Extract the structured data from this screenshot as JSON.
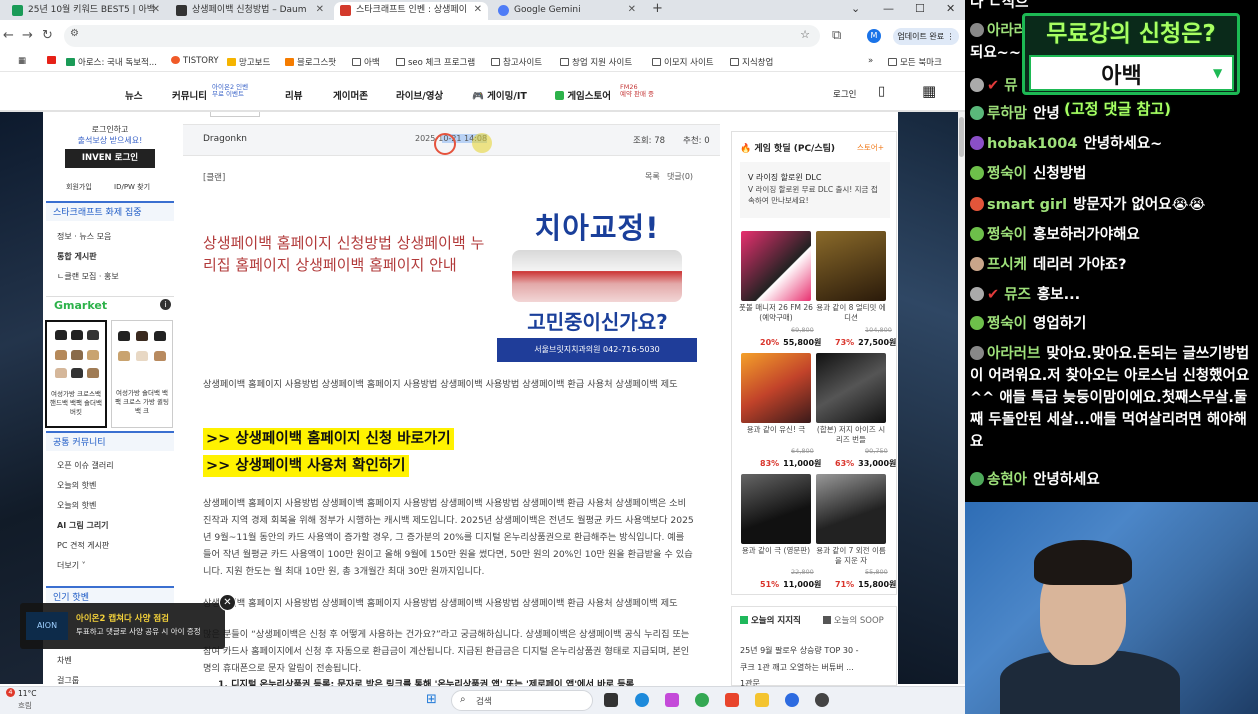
{
  "browser": {
    "tabs": [
      {
        "label": "25년 10월 키워드 BEST5 | 아백",
        "color": "#1a9b57"
      },
      {
        "label": "상생페이백 신청방법 – Daum",
        "color": "#333333"
      },
      {
        "label": "스타크래프트 인벤 : 상생페이",
        "color": "#d33a2c"
      },
      {
        "label": "Google Gemini",
        "color": "#4e7cf6"
      }
    ],
    "new_tab": "+",
    "window_controls": [
      "⌄",
      "—",
      "☐",
      "✕"
    ],
    "profile": "M",
    "update_label": "업데이트 완료 ⋮",
    "bookmarks": [
      "아로스: 국내 독보적...",
      "TISTORY",
      "망고보드",
      "블로그스팟",
      "아백",
      "seo 체크 프로그램",
      "참고사이트",
      "창업 지원 사이트",
      "이모지 사이트",
      "지식창업"
    ],
    "all_bookmarks": "모든 북마크"
  },
  "site": {
    "nav": [
      "뉴스",
      "커뮤니티",
      "리뷰",
      "게이머존",
      "라이브/영상",
      "게이밍/IT",
      "게임스토어",
      "로그인"
    ],
    "community_sub": "아이온2 인벤\n무료 이벤트",
    "store_sub": "FM26\n예약 판매 중",
    "login_box": {
      "line1": "로그인하고",
      "line2": "출석보상 받으세요!",
      "button": "INVEN 로그인",
      "signup": "회원가입",
      "find": "ID/PW 찾기"
    },
    "left_menu": {
      "header1": "스타크래프트 화제 집중",
      "items1": [
        "정보 · 뉴스 모음",
        "통합 게시판",
        "ㄴ클랜 모집 · 홍보"
      ],
      "gmarket": "Gmarket",
      "gm_products": [
        "여성가방 크로스백 핸드백 백팩 숄더백 버킷",
        "여성가방 숄더백 백팩 크로스 가방 퀼팅백 크"
      ],
      "header2": "공통 커뮤니티",
      "items2": [
        "오픈 이슈 갤러리",
        "오늘의 핫벤",
        "오늘의 핫벤",
        "AI 그림 그리기",
        "PC 견적 게시판",
        "더보기 ˅"
      ],
      "header3": "인기 핫벤",
      "items3": [
        "차벤",
        "걸그룹"
      ]
    },
    "post": {
      "author": "Dragonkn",
      "date": "2025-10-21 14:08",
      "views_label": "조회: 78",
      "recommend_label": "추천: 0",
      "category": "[클랜]",
      "list_link": "목록",
      "comment_link": "댓글(0)",
      "title": "상생페이백 홈페이지 신청방법 상생페이백 누리집 홈페이지 상생페이백 홈페이지 안내",
      "para1": "상생페이백 홈페이지 사용방법 상생페이백 홈페이지 사용방법 상생페이백 사용방법 상생페이백 환급 사용처 상생페이백 제도",
      "link1": ">> 상생페이백 홈페이지 신청 바로가기",
      "link2": ">> 상생페이백 사용처 확인하기",
      "para2": "상생페이백 홈페이지 사용방법 상생페이백 홈페이지 사용방법 상생페이백 사용방법 상생페이백 환급 사용처 상생페이백은 소비 진작과 지역 경제 회복을 위해 정부가 시행하는 캐시백 제도입니다. 2025년 상생페이백은 전년도 월평균 카드 사용액보다 2025년 9월~11월 동안의 카드 사용액이 증가할 경우, 그 증가분의 20%를 디지털 온누리상품권으로 환급해주는 방식입니다. 예를 들어 작년 월평균 카드 사용액이 100만 원이고 올해 9월에 150만 원을 썼다면, 50만 원의 20%인 10만 원을 환급받을 수 있습니다. 지원 한도는 월 최대 10만 원, 총 3개월간 최대 30만 원까지입니다.",
      "para3": "상생페이백 홈페이지 사용방법 상생페이백 홈페이지 사용방법 상생페이백 사용방법 상생페이백 환급 사용처 상생페이백 제도",
      "para4": "많은 분들이 “상생페이백은 신청 후 어떻게 사용하는 건가요?”라고 궁금해하십니다. 상생페이백은 상생페이백 공식 누리집 또는 참여 카드사 홈페이지에서 신청 후 자동으로 환급금이 계산됩니다. 지급된 환급금은 디지털 온누리상품권 형태로 지급되며, 본인 명의 휴대폰으로 문자 알림이 전송됩니다.",
      "para5": "1. 디지털 온누리상품권 등록: 문자로 받은 링크를 통해 '온누리상품권 앱' 또는 '제로페이 앱'에서 바로 등록"
    },
    "ad": {
      "title": "치아교정!",
      "question": "고민중이신가요?",
      "clinic": "서울브릿지치과의원  042-716-5030"
    },
    "hot_games": {
      "header": "게임 핫딜 (PC/스팀)",
      "more": "스토어+",
      "promo_title": "V 라이징 할로윈 DLC",
      "promo_desc": "V 라이징 할로윈 무료 DLC 출시! 지금 접속하여 만나보세요!",
      "items": [
        {
          "name": "풋볼 매니저 26 FM 26 (예약구매)",
          "old": "69,800",
          "discount": "20%",
          "price": "55,800원",
          "color": "#e8306f"
        },
        {
          "name": "용과 같이 8 얼티밋 에디션",
          "old": "104,800",
          "discount": "73%",
          "price": "27,500원",
          "color": "#8a6a2a"
        },
        {
          "name": "용과 같이 유신! 극",
          "old": "64,800",
          "discount": "83%",
          "price": "11,000원",
          "color": "#c2432a"
        },
        {
          "name": "(합본) 저지 아이즈 시리즈 번들",
          "old": "90,750",
          "discount": "63%",
          "price": "33,000원",
          "color": "#3a3a3a"
        },
        {
          "name": "용과 같이 극 (영문판)",
          "old": "22,800",
          "discount": "51%",
          "price": "11,000원",
          "color": "#2a2a2a"
        },
        {
          "name": "용과 같이 7 외전 이름을 지운 자",
          "old": "55,800",
          "discount": "71%",
          "price": "15,800원",
          "color": "#4a4a4a"
        }
      ]
    },
    "today": {
      "tab1": "오늘의 지지직",
      "tab2": "오늘의 SOOP",
      "items": [
        "25년 9월 팔로우 상승량 TOP 30 -",
        "쿠크 1관 깨고 오열하는 버튜버 ...",
        "1관문"
      ]
    },
    "popup": {
      "title": "아이온2 캡쳐다 사양 점검",
      "desc": "투표하고 댓글로 사양 공유 시 아이 증정"
    }
  },
  "taskbar": {
    "weather_temp": "11°C",
    "weather_desc": "흐림",
    "search": "검색",
    "badge": "4"
  },
  "stream": {
    "announcement": {
      "title": "무료강의 신청은?",
      "value": "아백",
      "note": "(고정 댓글 참고)"
    },
    "chat": [
      {
        "name": "",
        "msg": "다 ㄴ식으",
        "color": "#9ee07a"
      },
      {
        "name": "아라러",
        "msg": "",
        "color": "#9ee07a"
      },
      {
        "name": "",
        "msg": "되요~~",
        "color": "#9ee07a"
      },
      {
        "name": "뮤",
        "msg": "",
        "color": "#9ee07a"
      },
      {
        "name": "루하맘",
        "msg": "안녕",
        "color": "#9ee07a"
      },
      {
        "name": "hobak1004",
        "msg": "안녕하세요~",
        "color": "#9ee07a"
      },
      {
        "name": "쩡숙이",
        "msg": "신청방법",
        "color": "#9ee07a"
      },
      {
        "name": "smart girl",
        "msg": "방문자가 없어요😭😭",
        "color": "#9ee07a"
      },
      {
        "name": "쩡숙이",
        "msg": "홍보하러가야해요",
        "color": "#9ee07a"
      },
      {
        "name": "프시케",
        "msg": "데리러 가야죠?",
        "color": "#9ee07a"
      },
      {
        "name": "뮤즈",
        "msg": "홍보...",
        "color": "#9ee07a"
      },
      {
        "name": "쩡숙이",
        "msg": "영업하기",
        "color": "#9ee07a"
      },
      {
        "name": "아라러브",
        "msg": "맞아요.맞아요.돈되는 글쓰기방법이 어려워요.저 찾아오는 아로스님 신청했어요^^ 애들 특급 늦둥이맘이에요.첫째스무살.둘째 두돌안된 세살...애들 먹여살리려면 해야해요",
        "color": "#9ee07a"
      },
      {
        "name": "송현아",
        "msg": "안녕하세요",
        "color": "#9ee07a"
      }
    ]
  }
}
